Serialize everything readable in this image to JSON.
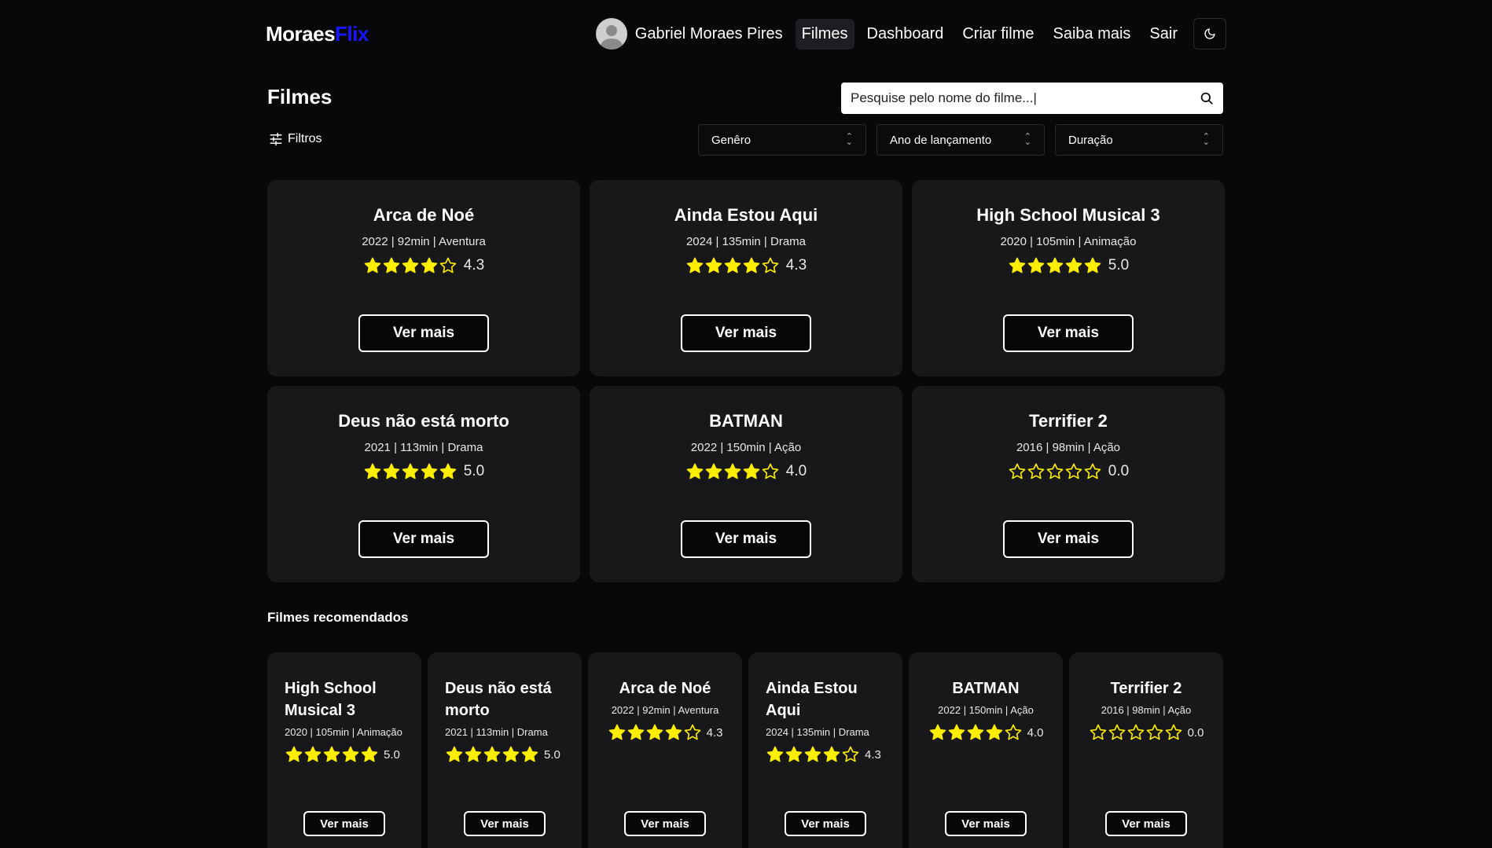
{
  "header": {
    "logo_main": "Moraes",
    "logo_accent": "Flix",
    "user_name": "Gabriel Moraes Pires",
    "nav": [
      "Filmes",
      "Dashboard",
      "Criar filme",
      "Saiba mais",
      "Sair"
    ],
    "active_nav": "Filmes",
    "theme_icon": "moon-icon"
  },
  "page": {
    "title": "Filmes",
    "search_placeholder": "Pesquise pelo nome do filme...|"
  },
  "filters": {
    "label": "Filtros",
    "selects": [
      "Genêro",
      "Ano de lançamento",
      "Duração"
    ]
  },
  "movies": [
    {
      "title": "Arca de Noé",
      "meta": "2022 | 92min | Aventura",
      "rating": 4.3,
      "rating_text": "4.3",
      "button": "Ver mais"
    },
    {
      "title": "Ainda Estou Aqui",
      "meta": "2024 | 135min | Drama",
      "rating": 4.3,
      "rating_text": "4.3",
      "button": "Ver mais"
    },
    {
      "title": "High School Musical 3",
      "meta": "2020 | 105min | Animação",
      "rating": 5.0,
      "rating_text": "5.0",
      "button": "Ver mais"
    },
    {
      "title": "Deus não está morto",
      "meta": "2021 | 113min | Drama",
      "rating": 5.0,
      "rating_text": "5.0",
      "button": "Ver mais"
    },
    {
      "title": "BATMAN",
      "meta": "2022 | 150min | Ação",
      "rating": 4.0,
      "rating_text": "4.0",
      "button": "Ver mais"
    },
    {
      "title": "Terrifier 2",
      "meta": "2016 | 98min | Ação",
      "rating": 0.0,
      "rating_text": "0.0",
      "button": "Ver mais"
    }
  ],
  "recommended": {
    "title": "Filmes recomendados",
    "items": [
      {
        "title": "High School Musical 3",
        "meta": "2020 | 105min | Animação",
        "rating": 5.0,
        "rating_text": "5.0",
        "button": "Ver mais",
        "align": "left"
      },
      {
        "title": "Deus não está morto",
        "meta": "2021 | 113min | Drama",
        "rating": 5.0,
        "rating_text": "5.0",
        "button": "Ver mais",
        "align": "left"
      },
      {
        "title": "Arca de Noé",
        "meta": "2022 | 92min | Aventura",
        "rating": 4.3,
        "rating_text": "4.3",
        "button": "Ver mais",
        "align": "center"
      },
      {
        "title": "Ainda Estou Aqui",
        "meta": "2024 | 135min | Drama",
        "rating": 4.3,
        "rating_text": "4.3",
        "button": "Ver mais",
        "align": "left"
      },
      {
        "title": "BATMAN",
        "meta": "2022 | 150min | Ação",
        "rating": 4.0,
        "rating_text": "4.0",
        "button": "Ver mais",
        "align": "center"
      },
      {
        "title": "Terrifier 2",
        "meta": "2016 | 98min | Ação",
        "rating": 0.0,
        "rating_text": "0.0",
        "button": "Ver mais",
        "align": "center"
      }
    ]
  },
  "colors": {
    "background": "#08080a",
    "card": "#18181b",
    "star": "#ffee00",
    "logo_accent": "#1717ff"
  }
}
